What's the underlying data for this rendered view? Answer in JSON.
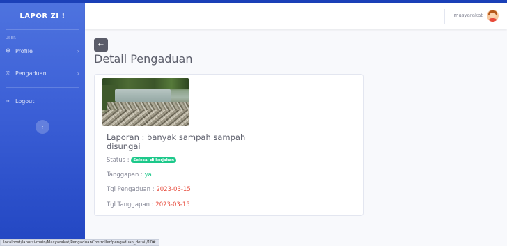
{
  "sidebar": {
    "brand": "LAPOR ZI !",
    "section_heading": "USER",
    "items": [
      {
        "label": "Profile",
        "icon": "user-icon",
        "chevron": "›"
      },
      {
        "label": "Pengaduan",
        "icon": "wrench-icon",
        "chevron": "›"
      },
      {
        "label": "Logout",
        "icon": "logout-icon"
      }
    ],
    "toggle_glyph": "‹"
  },
  "topbar": {
    "username": "masyarakat",
    "avatar_icon": "user-avatar"
  },
  "page": {
    "back_glyph": "←",
    "title": "Detail Pengaduan"
  },
  "card": {
    "image_icon": "river-trash-photo",
    "laporan_label": "Laporan : ",
    "laporan_value": "banyak sampah sampah disungai",
    "status_label": "Status : ",
    "status_badge": "Selesai di kerjakan",
    "tanggapan_label": "Tanggapan : ",
    "tanggapan_value": "ya",
    "tgl_pengaduan_label": "Tgl Pengaduan : ",
    "tgl_pengaduan_value": "2023-03-15",
    "tgl_tanggapan_label": "Tgl Tanggapan : ",
    "tgl_tanggapan_value": "2023-03-15"
  },
  "statusbar": {
    "url": "localhost/laporzi-main/Masyarakat/PengaduanController/pengaduan_detail/10#"
  },
  "colors": {
    "sidebar_top": "#4e73df",
    "sidebar_bottom": "#2246c2",
    "success": "#1cc88a",
    "danger": "#e74a3b",
    "text": "#5a5c69"
  }
}
